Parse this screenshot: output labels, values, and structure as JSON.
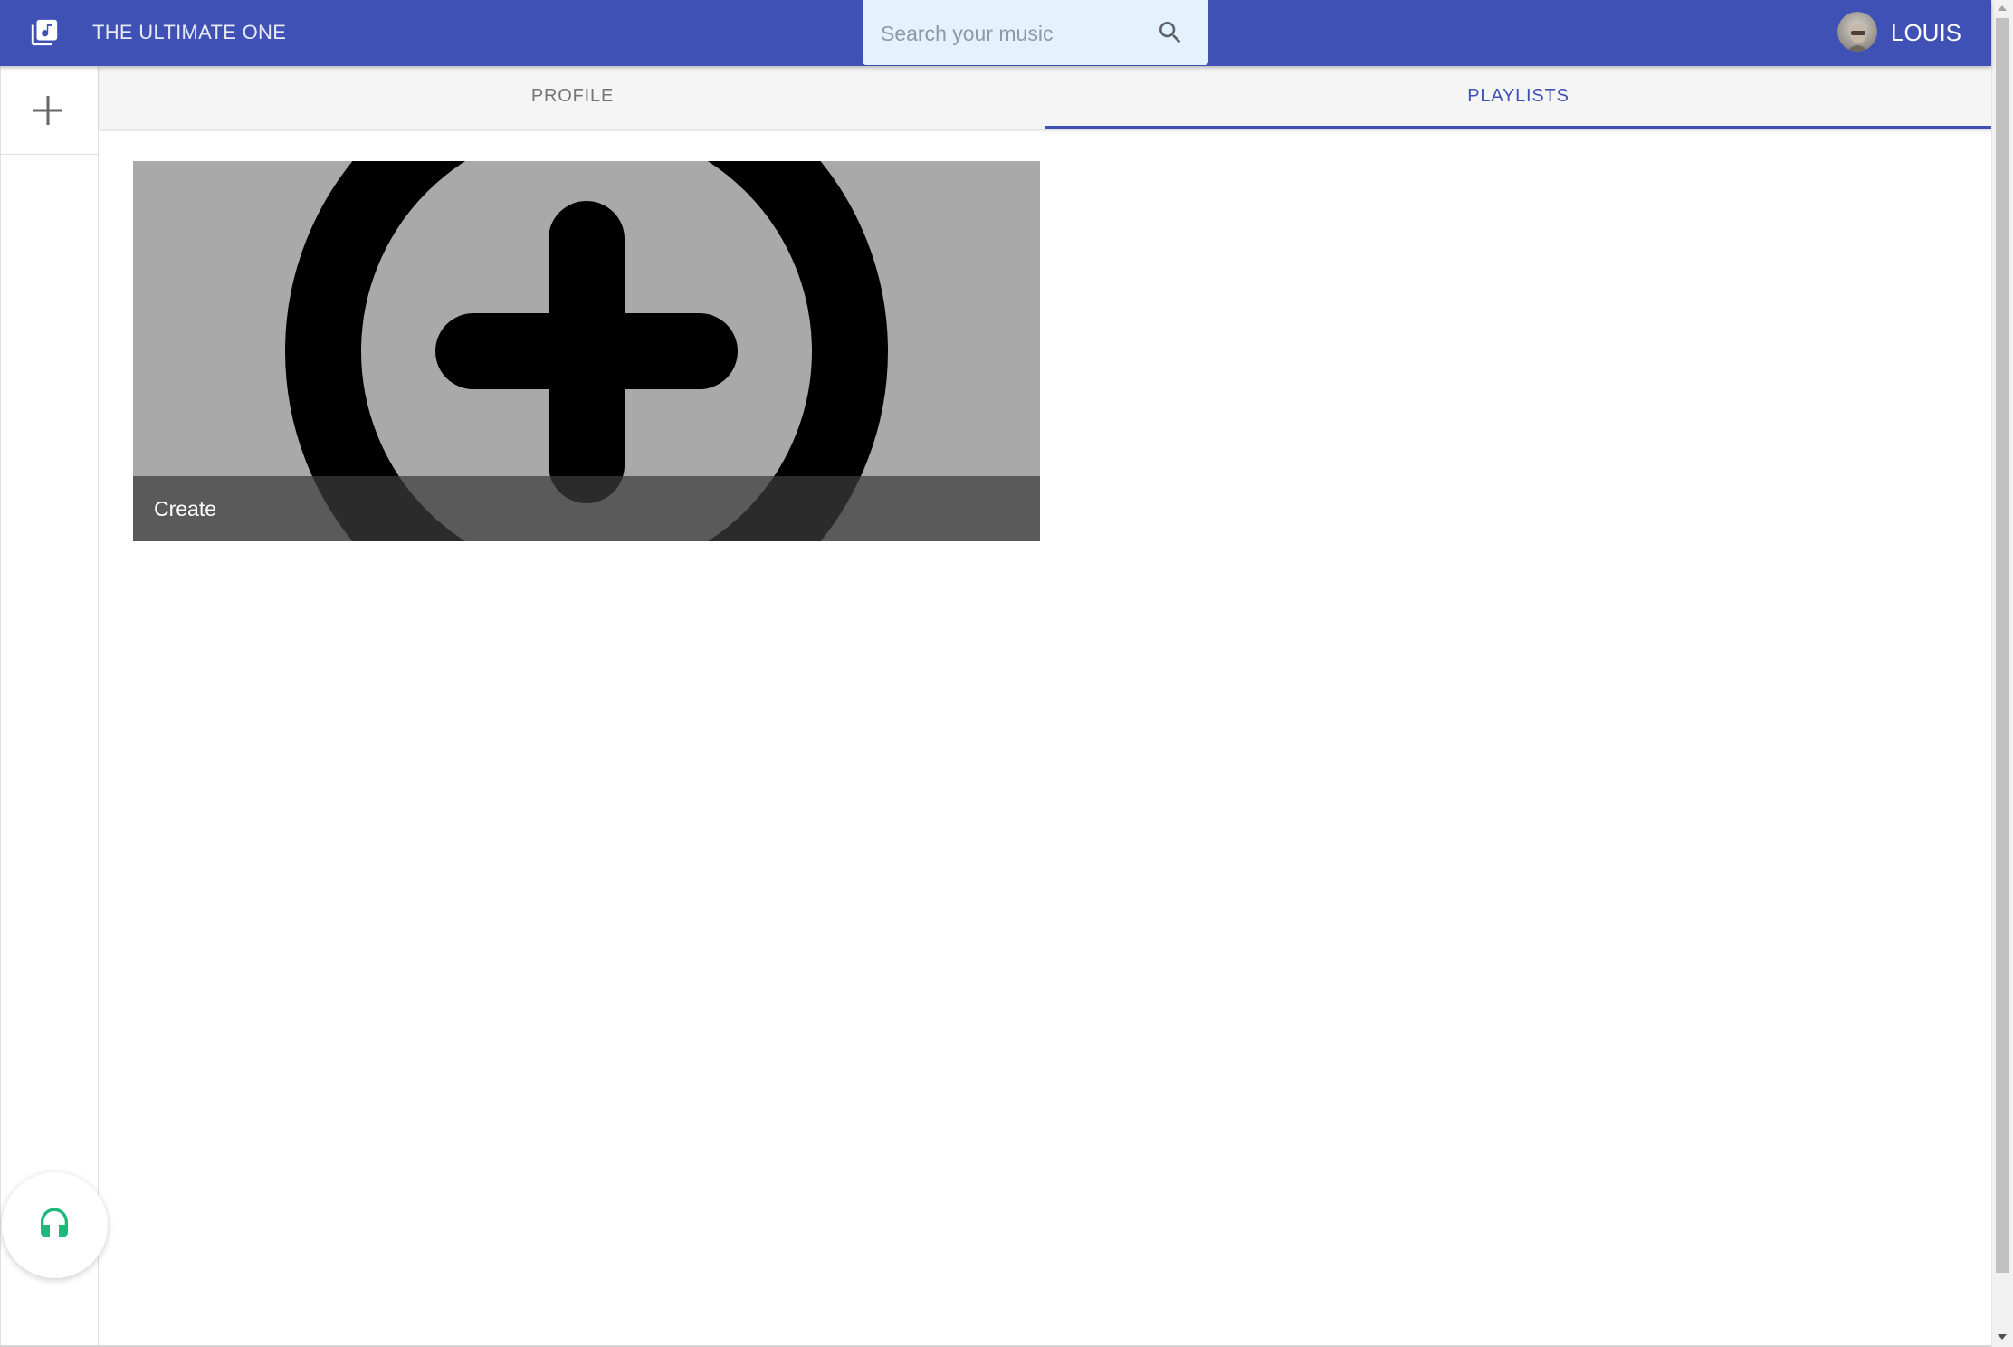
{
  "app": {
    "title": "THE ULTIMATE ONE",
    "icon": "music-library-icon"
  },
  "search": {
    "placeholder": "Search your music",
    "value": "",
    "icon": "search-icon"
  },
  "user": {
    "name": "LOUIS",
    "avatar": "avatar-photo"
  },
  "sidebar": {
    "add_icon": "plus-icon",
    "fab_icon": "headphones-icon"
  },
  "tabs": [
    {
      "label": "PROFILE",
      "active": false
    },
    {
      "label": "PLAYLISTS",
      "active": true
    }
  ],
  "playlists": [
    {
      "label": "Create",
      "icon": "add-circle-icon"
    }
  ],
  "colors": {
    "primary": "#3f51b5",
    "search_bg": "#e3f2fd",
    "fab_icon": "#1db87a",
    "tile_bg": "#a9a9a9"
  }
}
